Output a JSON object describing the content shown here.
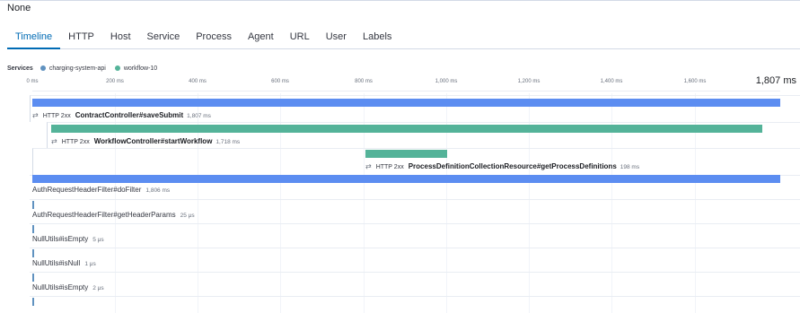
{
  "header": {
    "title": "None"
  },
  "tabs": [
    {
      "label": "Timeline",
      "active": true
    },
    {
      "label": "HTTP"
    },
    {
      "label": "Host"
    },
    {
      "label": "Service"
    },
    {
      "label": "Process"
    },
    {
      "label": "Agent"
    },
    {
      "label": "URL"
    },
    {
      "label": "User"
    },
    {
      "label": "Labels"
    }
  ],
  "services": {
    "label": "Services",
    "items": [
      {
        "name": "charging-system-api",
        "color": "#6092c0"
      },
      {
        "name": "workflow-10",
        "color": "#54b399"
      }
    ]
  },
  "axis": {
    "ticks": [
      "0 ms",
      "200 ms",
      "400 ms",
      "600 ms",
      "800 ms",
      "1,000 ms",
      "1,200 ms",
      "1,400 ms",
      "1,600 ms"
    ],
    "total": "1,807 ms"
  },
  "spans": [
    {
      "http": "HTTP 2xx",
      "name": "ContractController#saveSubmit",
      "duration": "1,807 ms",
      "color": "#5c8df1"
    },
    {
      "http": "HTTP 2xx",
      "name": "WorkflowController#startWorkflow",
      "duration": "1,718 ms",
      "color": "#54b399"
    },
    {
      "http": "HTTP 2xx",
      "name": "ProcessDefinitionCollectionResource#getProcessDefinitions",
      "duration": "198 ms",
      "color": "#54b399"
    },
    {
      "name": "AuthRequestHeaderFilter#doFilter",
      "duration": "1,806 ms",
      "color": "#5c8df1"
    },
    {
      "name": "AuthRequestHeaderFilter#getHeaderParams",
      "duration": "25 μs",
      "color": "#5c8df1"
    },
    {
      "name": "NullUtils#isEmpty",
      "duration": "5 μs",
      "color": "#5c8df1"
    },
    {
      "name": "NullUtils#isNull",
      "duration": "1 μs",
      "color": "#5c8df1"
    },
    {
      "name": "NullUtils#isEmpty",
      "duration": "2 μs",
      "color": "#5c8df1"
    }
  ]
}
